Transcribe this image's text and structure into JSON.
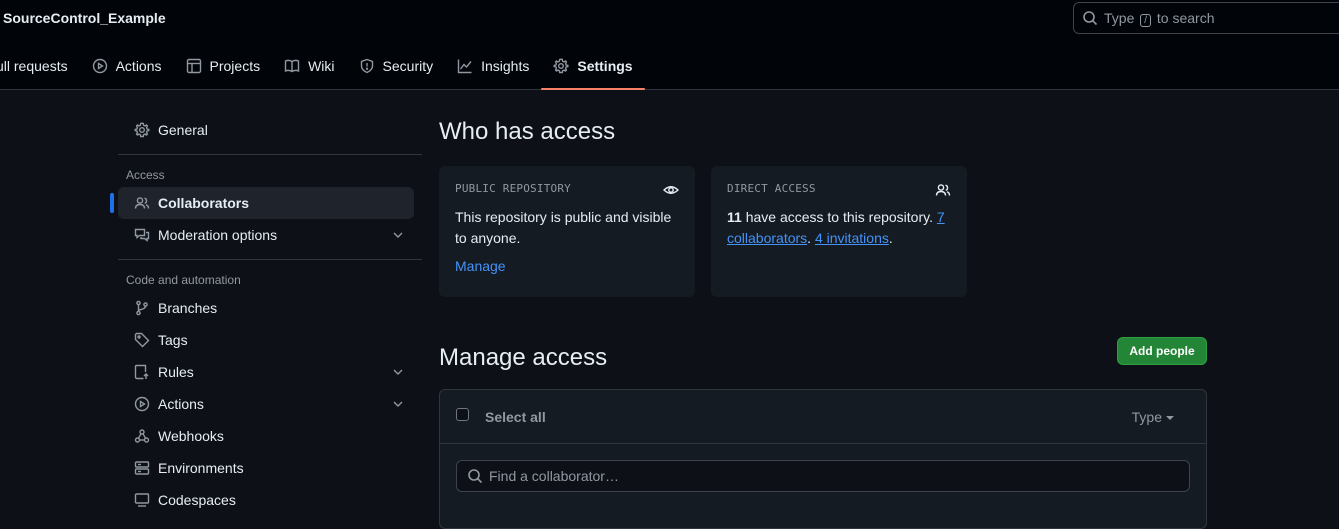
{
  "header": {
    "repo_title": "SourceControl_Example",
    "search_prefix": "Type",
    "search_key": "/",
    "search_suffix": "to search"
  },
  "tabs": [
    {
      "label": "ull requests",
      "icon": "pull-request-icon"
    },
    {
      "label": "Actions",
      "icon": "play-icon"
    },
    {
      "label": "Projects",
      "icon": "table-icon"
    },
    {
      "label": "Wiki",
      "icon": "book-icon"
    },
    {
      "label": "Security",
      "icon": "shield-icon"
    },
    {
      "label": "Insights",
      "icon": "graph-icon"
    },
    {
      "label": "Settings",
      "icon": "gear-icon",
      "active": true
    }
  ],
  "sidebar": {
    "general": "General",
    "access_group": "Access",
    "collaborators": "Collaborators",
    "moderation": "Moderation options",
    "code_group": "Code and automation",
    "branches": "Branches",
    "tags": "Tags",
    "rules": "Rules",
    "actions": "Actions",
    "webhooks": "Webhooks",
    "environments": "Environments",
    "codespaces": "Codespaces"
  },
  "main": {
    "who_title": "Who has access",
    "public_card": {
      "label": "PUBLIC REPOSITORY",
      "text": "This repository is public and visible to anyone.",
      "link": "Manage"
    },
    "direct_card": {
      "label": "DIRECT ACCESS",
      "count": "11",
      "text_mid": " have access to this repository. ",
      "collab_link": "7 collaborators",
      "sep": ". ",
      "invite_link": "4 invitations",
      "end": "."
    },
    "manage_title": "Manage access",
    "add_button": "Add people",
    "select_all": "Select all",
    "type_filter": "Type",
    "find_placeholder": "Find a collaborator…"
  },
  "colors": {
    "accent_tab": "#f78166",
    "link": "#4493f8",
    "primary_button": "#238636",
    "selected_marker": "#1f6feb"
  }
}
